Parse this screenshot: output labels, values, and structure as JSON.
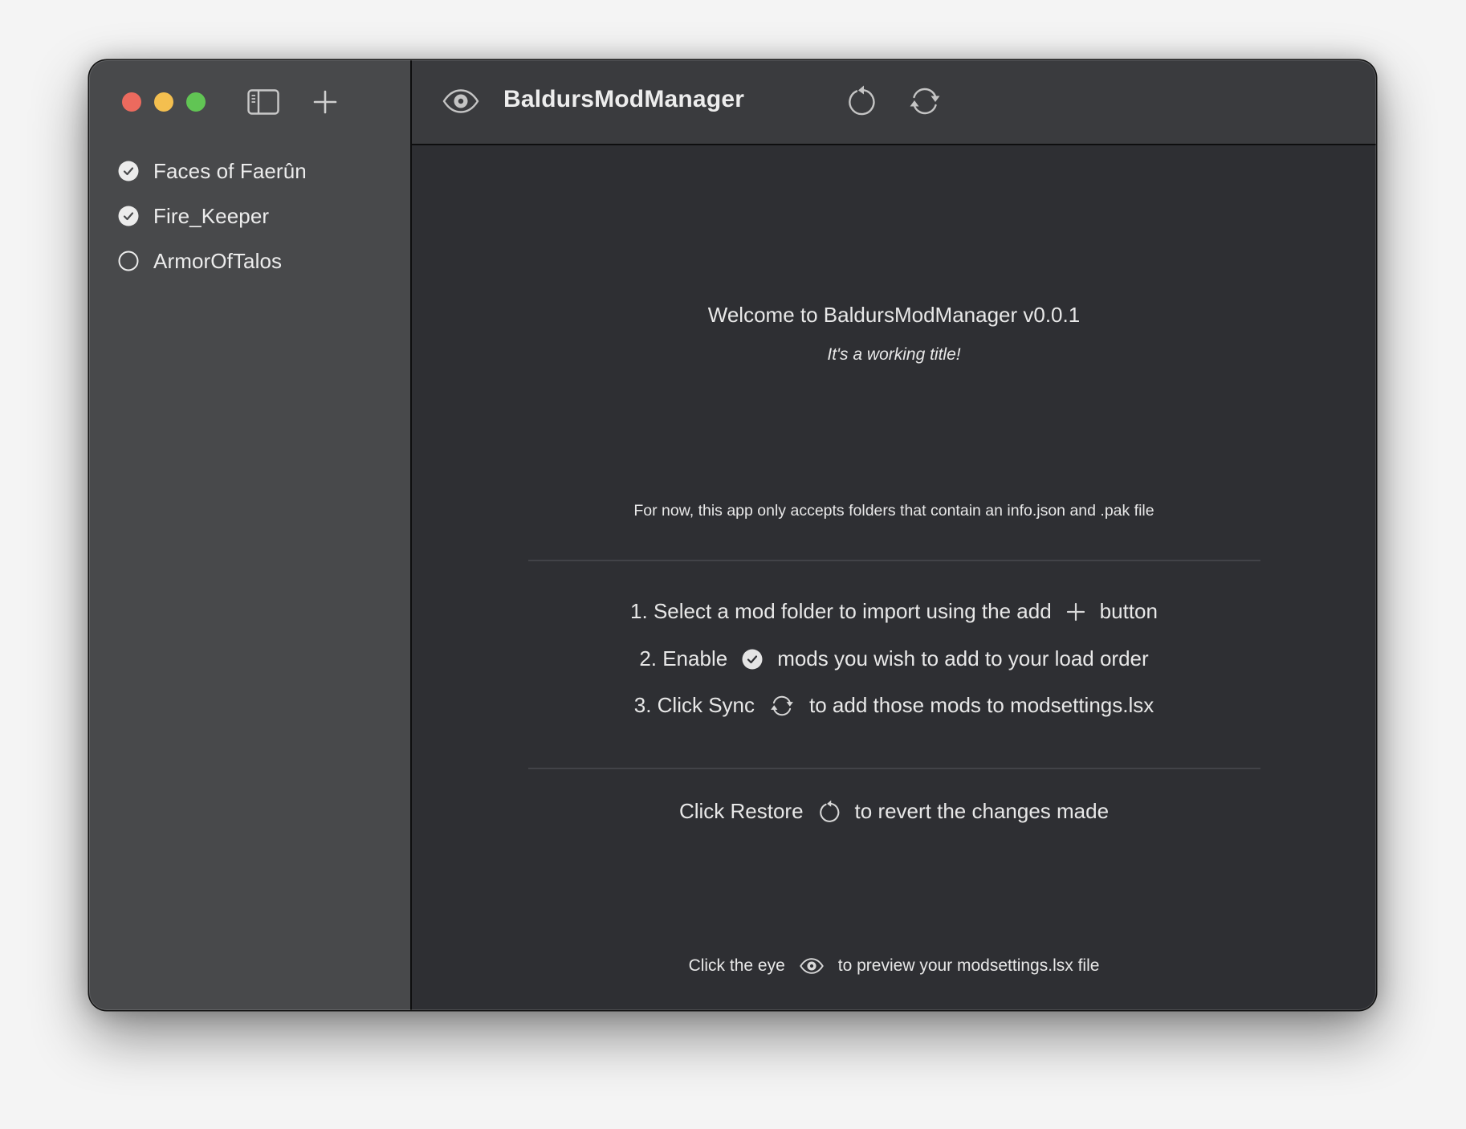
{
  "window": {
    "traffic_lights": [
      {
        "name": "close",
        "color": "#ec6a5e"
      },
      {
        "name": "minimize",
        "color": "#f4bf4f"
      },
      {
        "name": "zoom",
        "color": "#61c554"
      }
    ]
  },
  "sidebar": {
    "toggle_icon": "sidebar-left-icon",
    "add_icon": "plus-icon",
    "mods": [
      {
        "label": "Faces of Faerûn",
        "enabled": true
      },
      {
        "label": "Fire_Keeper",
        "enabled": true
      },
      {
        "label": "ArmorOfTalos",
        "enabled": false
      }
    ]
  },
  "toolbar": {
    "preview_icon": "eye-icon",
    "title": "BaldursModManager",
    "restore_icon": "restore-icon",
    "sync_icon": "sync-icon"
  },
  "main": {
    "welcome": "Welcome to BaldursModManager v0.0.1",
    "subtitle": "It's a working title!",
    "note": "For now, this app only accepts folders that contain an info.json and .pak file",
    "steps": [
      {
        "before": "1. Select a mod folder to import using the add",
        "icon": "plus-icon",
        "after": "button"
      },
      {
        "before": "2. Enable",
        "icon": "checkmark-circle-icon",
        "after": "mods you wish to add to your load order"
      },
      {
        "before": "3. Click Sync",
        "icon": "sync-icon",
        "after": "to add those mods to modsettings.lsx"
      }
    ],
    "restore_hint": {
      "before": "Click Restore",
      "icon": "restore-icon",
      "after": "to revert the changes made"
    },
    "eye_hint": {
      "before": "Click the eye",
      "icon": "eye-icon",
      "after": "to preview your modsettings.lsx file"
    }
  }
}
